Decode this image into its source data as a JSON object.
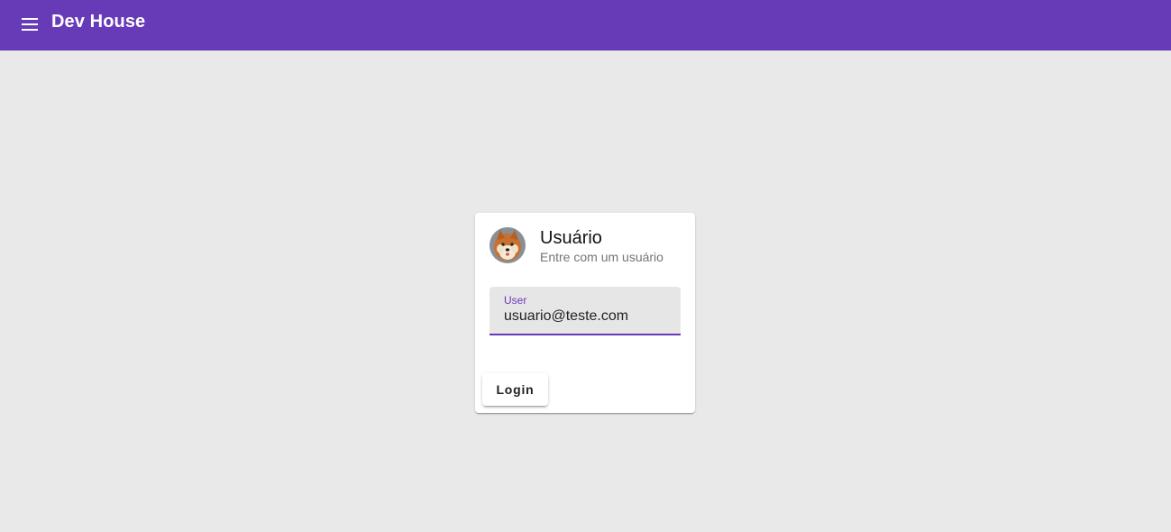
{
  "header": {
    "title": "Dev House",
    "menu_icon": "menu-icon",
    "background_color": "#673ab7"
  },
  "login_card": {
    "avatar_icon": "dog-avatar-icon",
    "title": "Usuário",
    "subtitle": "Entre com um usuário",
    "user_field": {
      "label": "User",
      "value": "usuario@teste.com"
    },
    "login_button_label": "Login"
  },
  "colors": {
    "accent": "#673ab7",
    "page_background": "#e9e9e9"
  }
}
